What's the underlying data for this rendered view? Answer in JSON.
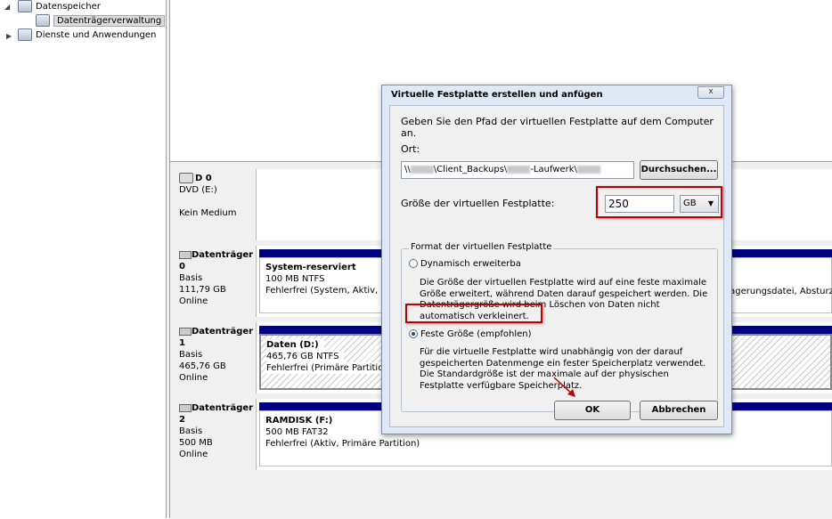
{
  "tree": {
    "items": [
      {
        "label": "Datenspeicher"
      },
      {
        "label": "Datenträgerverwaltung"
      },
      {
        "label": "Dienste und Anwendungen"
      }
    ]
  },
  "disks": [
    {
      "name": "D 0",
      "line2": "DVD (E:)",
      "line3": "",
      "line4": "Kein Medium"
    },
    {
      "name": "Datenträger 0",
      "line2": "Basis",
      "line3": "111,79 GB",
      "line4": "Online",
      "partition": {
        "name": "System-reserviert",
        "size": "100 MB NTFS",
        "status": "Fehlerfrei (System, Aktiv, Prim"
      },
      "right_text": "Auslagerungsdatei, Absturzabbild"
    },
    {
      "name": "Datenträger 1",
      "line2": "Basis",
      "line3": "465,76 GB",
      "line4": "Online",
      "partition": {
        "name": "Daten (D:)",
        "size": "465,76 GB NTFS",
        "status": "Fehlerfrei (Primäre Partition)"
      }
    },
    {
      "name": "Datenträger 2",
      "line2": "Basis",
      "line3": "500 MB",
      "line4": "Online",
      "partition": {
        "name": "RAMDISK (F:)",
        "size": "500 MB FAT32",
        "status": "Fehlerfrei (Aktiv, Primäre Partition)"
      }
    }
  ],
  "dialog": {
    "title": "Virtuelle Festplatte erstellen und anfügen",
    "close": "x",
    "intro": "Geben Sie den Pfad der virtuellen Festplatte auf dem Computer an.",
    "location_label": "Ort:",
    "path_prefix": "\\\\",
    "path_mid1": "\\Client_Backups\\",
    "path_mid2": "-Laufwerk\\",
    "browse_label": "Durchsuchen...",
    "size_label": "Größe der virtuellen Festplatte:",
    "size_value": "250",
    "unit_value": "GB",
    "format_group": "Format der virtuellen Festplatte",
    "dynamic_label": "Dynamisch erweiterba",
    "dynamic_desc": "Die Größe der virtuellen Festplatte wird auf eine feste maximale Größe erweitert, während Daten darauf gespeichert werden. Die Datenträgergröße wird beim Löschen von Daten nicht automatisch verkleinert.",
    "fixed_label": "Feste Größe (empfohlen)",
    "fixed_desc": "Für die virtuelle Festplatte wird unabhängig von der darauf gespeicherten Datenmenge ein fester Speicherplatz verwendet. Die Standardgröße ist der maximale auf der physischen Festplatte verfügbare Speicherplatz.",
    "selected_format": "fixed",
    "ok_label": "OK",
    "cancel_label": "Abbrechen"
  },
  "colors": {
    "disk_bar": "#000080",
    "highlight": "#c00000",
    "dialog_frame": "#dfe9f5"
  }
}
